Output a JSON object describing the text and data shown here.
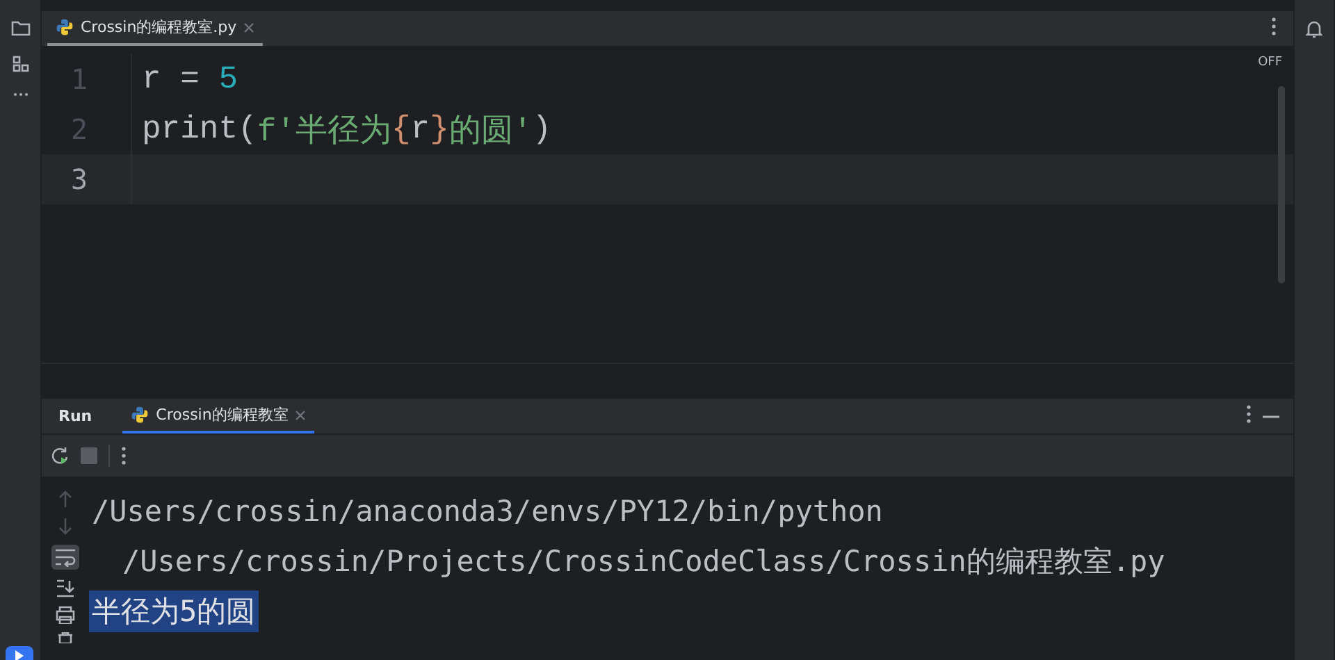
{
  "editor": {
    "tabs": [
      {
        "label": "Crossin的编程教室.py",
        "selected": true
      }
    ],
    "reader_mode": "OFF",
    "lines": [
      {
        "number": "1",
        "current": false,
        "tokens": [
          {
            "text": "r",
            "kind": "plain"
          },
          {
            "text": " = ",
            "kind": "plain"
          },
          {
            "text": "5",
            "kind": "number"
          }
        ]
      },
      {
        "number": "2",
        "current": false,
        "tokens": [
          {
            "text": "print(",
            "kind": "plain"
          },
          {
            "text": "f'半径为",
            "kind": "string"
          },
          {
            "text": "{",
            "kind": "brace"
          },
          {
            "text": "r",
            "kind": "plain"
          },
          {
            "text": "}",
            "kind": "brace"
          },
          {
            "text": "的圆'",
            "kind": "string"
          },
          {
            "text": ")",
            "kind": "plain"
          }
        ]
      },
      {
        "number": "3",
        "current": true
      }
    ]
  },
  "run": {
    "title": "Run",
    "tabs": [
      {
        "label": "Crossin的编程教室",
        "selected": true
      }
    ],
    "lines": [
      {
        "text": "/Users/crossin/anaconda3/envs/PY12/bin/python",
        "kind": "command",
        "selected": false
      },
      {
        "text": "/Users/crossin/Projects/CrossinCodeClass/Crossin的编程教室.py",
        "kind": "wrap",
        "selected": false
      },
      {
        "text": "半径为5的圆",
        "kind": "output",
        "selected": true
      }
    ]
  }
}
